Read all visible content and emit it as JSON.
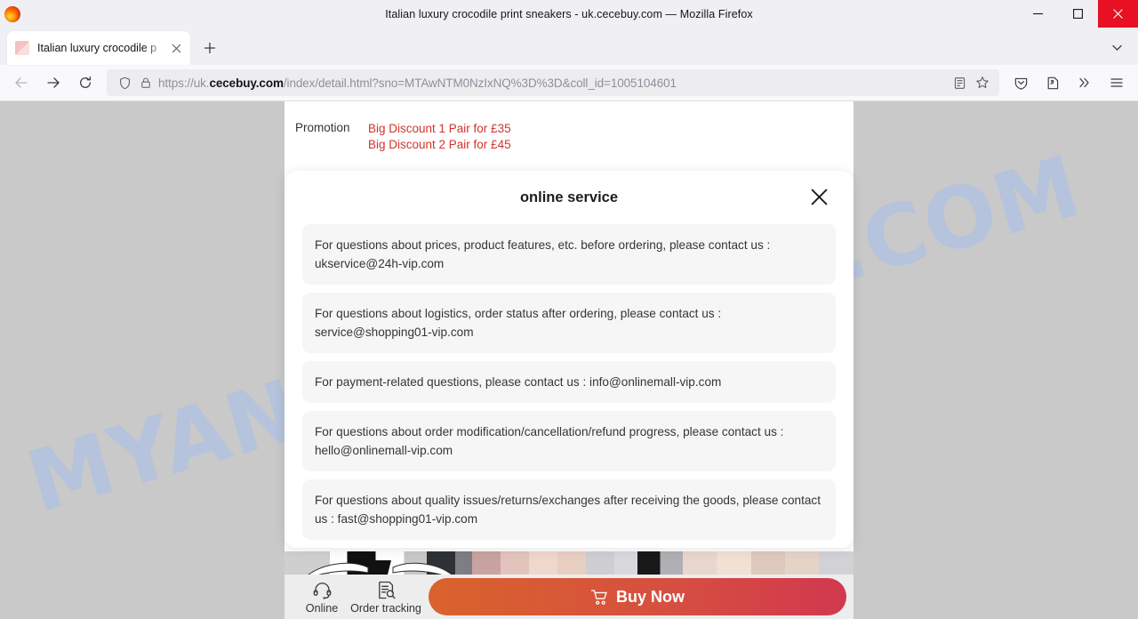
{
  "window": {
    "title": "Italian luxury crocodile print sneakers - uk.cecebuy.com — Mozilla Firefox",
    "minimize_label": "minimize-icon",
    "maximize_label": "maximize-icon",
    "close_label": "close-icon"
  },
  "tabs": {
    "active": {
      "label": "Italian luxury crocodile p",
      "close_label": "✕"
    },
    "new_tab_label": "+",
    "list_all_tabs_label": "list-all-tabs-icon"
  },
  "toolbar": {
    "back_label": "back-icon",
    "forward_label": "forward-icon",
    "reload_label": "reload-icon",
    "url_prefix": "https://uk.",
    "url_domain": "cecebuy.com",
    "url_rest": "/index/detail.html?sno=MTAwNTM0NzIxNQ%3D%3D&coll_id=1005104601",
    "shield_label": "shield-icon",
    "lock_label": "lock-icon",
    "reader_label": "reader-mode-icon",
    "bookmark_label": "bookmark-star-icon",
    "pocket_label": "pocket-save-icon",
    "extensions_label": "extensions-icon",
    "overflow_label": "»",
    "menu_label": "hamburger-menu-icon"
  },
  "page": {
    "watermark": "MYANTISPYWARE.COM",
    "promotion": {
      "label": "Promotion",
      "lines": [
        "Big Discount  1 Pair for £35",
        "Big Discount  2 Pair for £45"
      ]
    },
    "modal": {
      "title": "online service",
      "close_label": "✕",
      "items": [
        "For questions about prices, product features, etc. before ordering, please contact us : ukservice@24h-vip.com",
        "For questions about logistics, order status after ordering, please contact us : service@shopping01-vip.com",
        "For payment-related questions, please contact us : info@onlinemall-vip.com",
        "For questions about order modification/cancellation/refund progress, please contact us : hello@onlinemall-vip.com",
        "For questions about quality issues/returns/exchanges after receiving the goods, please contact us : fast@shopping01-vip.com"
      ]
    },
    "bottom_bar": {
      "online_label": "Online",
      "online_icon": "headset-icon",
      "order_tracking_label": "Order tracking",
      "order_tracking_icon": "order-tracking-icon",
      "buy_now_label": "Buy Now",
      "cart_icon": "shopping-cart-icon"
    }
  },
  "colors": {
    "accent_promo": "#d0342c",
    "buy_gradient_start": "#d9632c",
    "buy_gradient_end": "#d2384f",
    "watermark": "#a9c0e8",
    "close_button": "#e81123"
  }
}
